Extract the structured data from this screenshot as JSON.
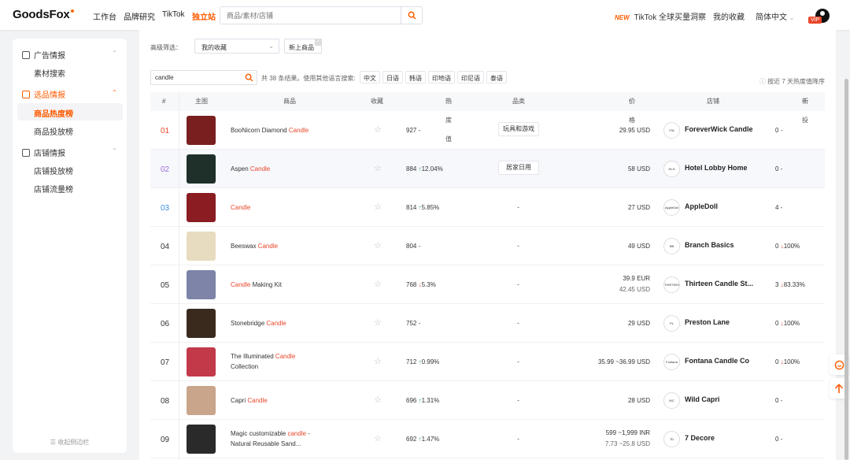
{
  "brand": {
    "logo_text": "GoodsFox"
  },
  "nav": [
    "工作台",
    "品牌研究",
    "TikTok",
    "独立站"
  ],
  "search": {
    "placeholder": "商品/素材/店铺"
  },
  "top_right": {
    "new_tag": "NEW",
    "tiktok_link": "TikTok 全球买量洞察",
    "favorites": "我的收藏",
    "language": "简体中文",
    "vip": "VIP"
  },
  "sidebar": {
    "sections": [
      {
        "label": "广告情报",
        "items": [
          "素材搜索"
        ]
      },
      {
        "label": "选品情报",
        "items": [
          "商品热度榜",
          "商品投放榜"
        ]
      },
      {
        "label": "店铺情报",
        "items": [
          "店铺投放榜",
          "店铺流量榜"
        ]
      }
    ],
    "collapse_label": "收起侧边栏"
  },
  "filters": {
    "advanced_label": "高级筛选：",
    "dropdown_value": "我的收藏",
    "new_products_btn": "新上商品"
  },
  "keyword": {
    "value": "candle"
  },
  "results_text": "共 38 条结果。使用其他语言搜索:",
  "languages": [
    "中文",
    "日语",
    "韩语",
    "印地语",
    "印尼语",
    "泰语"
  ],
  "sort_hint": "按近 7 天热度值降序",
  "columns": [
    "#",
    "主图",
    "商品",
    "收藏",
    "热度值",
    "品类",
    "价格",
    "店铺",
    "新投"
  ],
  "rows": [
    {
      "rank": "01",
      "rank_color": "#e8472b",
      "name_pre": "BooNicorn Diamond ",
      "name_kw": "Candle",
      "name_post": "",
      "heat": "927",
      "change": "-",
      "dir": "none",
      "category": "玩具和游戏",
      "price1": "29.95 USD",
      "price2": "",
      "shop": "ForeverWick Candle",
      "new": "0",
      "new_change": "-",
      "new_dir": "none"
    },
    {
      "rank": "02",
      "rank_color": "#9b6bd6",
      "name_pre": "Aspen ",
      "name_kw": "Candle",
      "name_post": "",
      "heat": "884",
      "change": "12.04%",
      "dir": "up",
      "category": "居家日用",
      "price1": "58 USD",
      "price2": "",
      "shop": "Hotel Lobby Home",
      "new": "0",
      "new_change": "-",
      "new_dir": "none"
    },
    {
      "rank": "03",
      "rank_color": "#3a8ee6",
      "name_pre": "",
      "name_kw": "Candle",
      "name_post": "",
      "heat": "814",
      "change": "5.85%",
      "dir": "up",
      "category": "-",
      "price1": "27 USD",
      "price2": "",
      "shop": "AppleDoll",
      "new": "4",
      "new_change": "-",
      "new_dir": "none"
    },
    {
      "rank": "04",
      "rank_color": "#333333",
      "name_pre": "Beeswax ",
      "name_kw": "Candle",
      "name_post": "",
      "heat": "804",
      "change": "-",
      "dir": "none",
      "category": "-",
      "price1": "49 USD",
      "price2": "",
      "shop": "Branch Basics",
      "new": "0",
      "new_change": "100%",
      "new_dir": "down"
    },
    {
      "rank": "05",
      "rank_color": "#333333",
      "name_pre": "",
      "name_kw": "Candle",
      "name_post": " Making Kit",
      "heat": "768",
      "change": "5.3%",
      "dir": "down",
      "category": "-",
      "price1": "39.9 EUR",
      "price2": "42.45 USD",
      "shop": "Thirteen Candle St...",
      "new": "3",
      "new_change": "83.33%",
      "new_dir": "down"
    },
    {
      "rank": "06",
      "rank_color": "#333333",
      "name_pre": "Stonebridge ",
      "name_kw": "Candle",
      "name_post": "",
      "heat": "752",
      "change": "-",
      "dir": "none",
      "category": "-",
      "price1": "29 USD",
      "price2": "",
      "shop": "Preston Lane",
      "new": "0",
      "new_change": "100%",
      "new_dir": "down"
    },
    {
      "rank": "07",
      "rank_color": "#333333",
      "name_pre": "The Illuminated ",
      "name_kw": "Candle",
      "name_post": " Collection",
      "heat": "712",
      "change": "0.99%",
      "dir": "up",
      "category": "-",
      "price1": "35.99 ~36.99 USD",
      "price2": "",
      "shop": "Fontana Candle Co",
      "new": "0",
      "new_change": "100%",
      "new_dir": "down"
    },
    {
      "rank": "08",
      "rank_color": "#333333",
      "name_pre": "Capri ",
      "name_kw": "Candle",
      "name_post": "",
      "heat": "696",
      "change": "1.31%",
      "dir": "up",
      "category": "-",
      "price1": "28 USD",
      "price2": "",
      "shop": "Wild Capri",
      "new": "0",
      "new_change": "-",
      "new_dir": "none"
    },
    {
      "rank": "09",
      "rank_color": "#333333",
      "name_pre": "Magic customizable ",
      "name_kw": "candle",
      "name_post": " - Natural Reusable Sand...",
      "heat": "692",
      "change": "1.47%",
      "dir": "up",
      "category": "-",
      "price1": "599 ~1,999 INR",
      "price2": "7.73 ~25.8 USD",
      "shop": "7 Decore",
      "new": "0",
      "new_change": "-",
      "new_dir": "none"
    }
  ],
  "thumb_colors": [
    "#7a1f1f",
    "#1f2f2a",
    "#8a1c22",
    "#e8dcc0",
    "#7d84a8",
    "#3a2a1e",
    "#c23a4a",
    "#c9a58c",
    "#2a2a2a"
  ],
  "shop_logo_text": [
    "FW",
    "HLH",
    "AppleDoll",
    "BB",
    "THIRTEEN",
    "PL",
    "Fontana",
    "WC",
    "7D"
  ]
}
